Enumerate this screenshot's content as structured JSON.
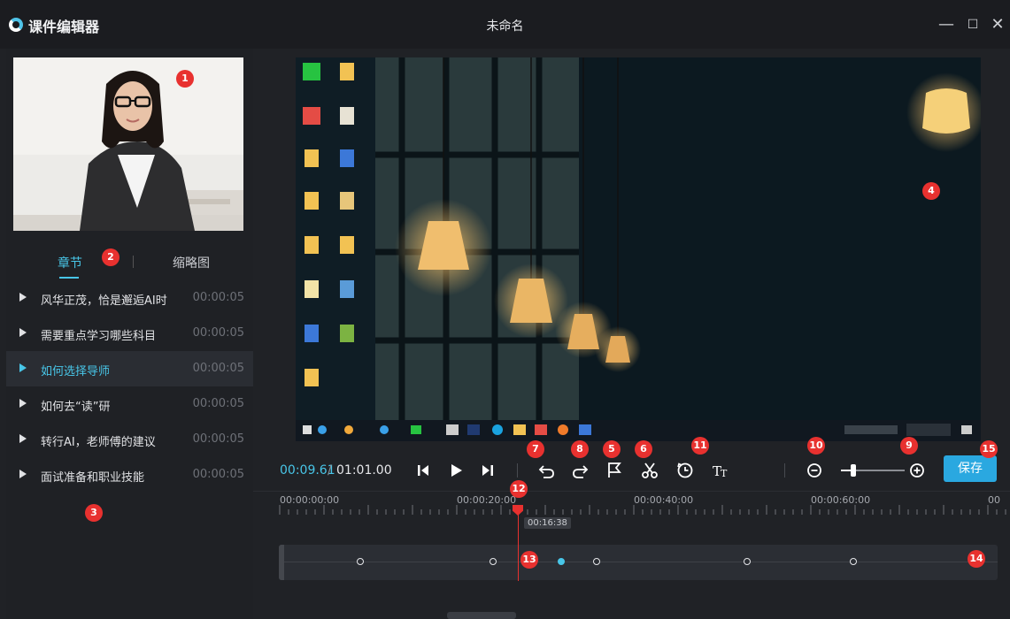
{
  "window": {
    "app_name": "课件编辑器",
    "doc_title": "未命名",
    "minimize": "—",
    "maximize": "☐",
    "close": "✕"
  },
  "tabs": {
    "chapters": "章节",
    "thumbnails": "缩略图"
  },
  "chapters": [
    {
      "title": "风华正茂，恰是邂逅AI时",
      "time": "00:00:05",
      "active": false
    },
    {
      "title": "需要重点学习哪些科目",
      "time": "00:00:05",
      "active": false
    },
    {
      "title": "如何选择导师",
      "time": "00:00:05",
      "active": true
    },
    {
      "title": "如何去“读”研",
      "time": "00:00:05",
      "active": false
    },
    {
      "title": "转行AI，老师傅的建议",
      "time": "00:00:05",
      "active": false
    },
    {
      "title": "面试准备和职业技能",
      "time": "00:00:05",
      "active": false
    }
  ],
  "player": {
    "current_time": "00:09.61",
    "separator": "/",
    "total_time": "01:01.00",
    "save_label": "保存",
    "zoom_level": 0.2
  },
  "timeline": {
    "ruler_labels": [
      "00:00:00:00",
      "00:00:20:00",
      "00:00:40:00",
      "00:00:60:00",
      "00"
    ],
    "playhead_time": "00:16:38"
  },
  "badges": [
    "1",
    "2",
    "3",
    "4",
    "5",
    "6",
    "7",
    "8",
    "9",
    "10",
    "11",
    "12",
    "13",
    "14",
    "15"
  ],
  "colors": {
    "accent": "#48c6e8",
    "badge": "#e8312f",
    "save": "#2aa8e0"
  }
}
